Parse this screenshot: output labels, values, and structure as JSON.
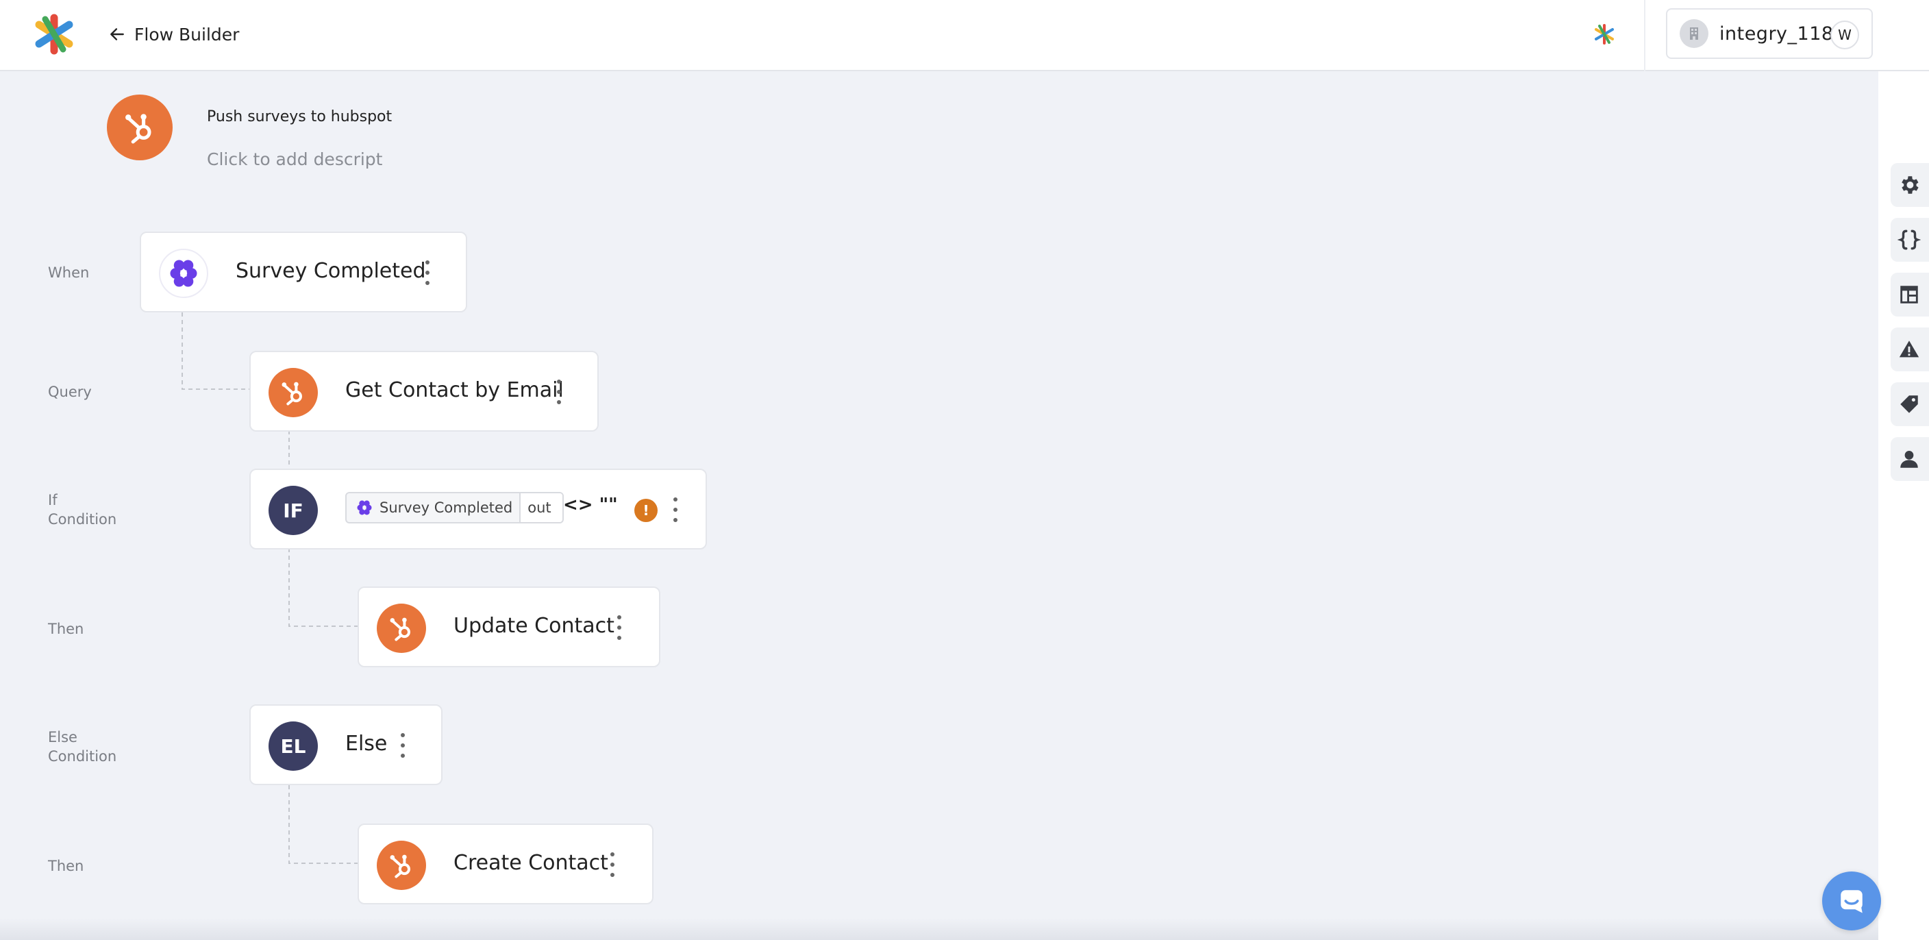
{
  "header": {
    "back_label": "Flow Builder",
    "account_name": "integry_118",
    "avatar_initial": "W"
  },
  "flow": {
    "title": "Push surveys to hubspot",
    "description_placeholder": "Click to add descript"
  },
  "steps": [
    {
      "label": "When",
      "title": "Survey Completed",
      "icon": "survey-app-icon"
    },
    {
      "label": "Query",
      "title": "Get Contact by Email",
      "icon": "hubspot-icon"
    },
    {
      "label_line1": "If",
      "label_line2": "Condition",
      "icon_text": "IF",
      "condition": {
        "source_label": "Survey Completed",
        "field": "out",
        "operator": "<> \"\""
      }
    },
    {
      "label": "Then",
      "title": "Update Contact",
      "icon": "hubspot-icon"
    },
    {
      "label_line1": "Else",
      "label_line2": "Condition",
      "icon_text": "EL",
      "title": "Else"
    },
    {
      "label": "Then",
      "title": "Create Contact",
      "icon": "hubspot-icon"
    }
  ],
  "warning_mark": "!",
  "right_rail": [
    "gear-icon",
    "braces-icon",
    "table-layout-icon",
    "warning-icon",
    "tag-icon",
    "user-icon"
  ],
  "colors": {
    "hubspot_orange": "#e8753a",
    "condition_dark": "#3b3e63",
    "survey_purple": "#6a3ee8",
    "warning_orange": "#d9781f",
    "chat_blue": "#5a95e8"
  }
}
